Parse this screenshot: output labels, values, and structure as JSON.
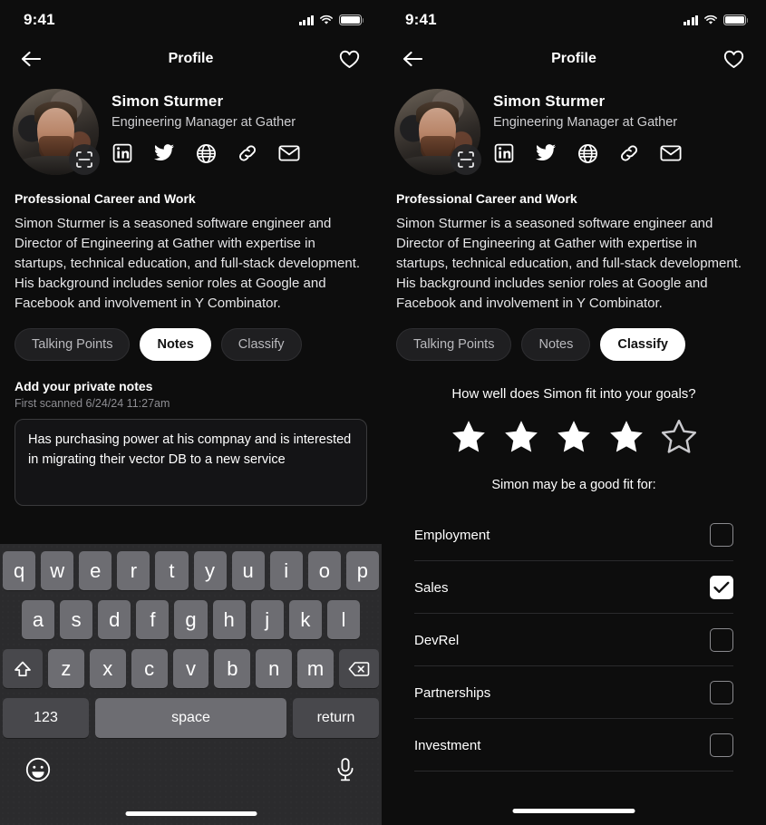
{
  "panels": {
    "left": {
      "status": {
        "time": "9:41",
        "cellular_icon": "signal-bars-icon",
        "wifi_icon": "wifi-icon",
        "battery_icon": "battery-full-icon"
      },
      "nav": {
        "back_icon": "back-arrow-icon",
        "title": "Profile",
        "favorite_icon": "heart-icon"
      },
      "profile": {
        "avatar_name": "profile-photo",
        "scan_badge_icon": "scan-frame-icon",
        "name": "Simon Sturmer",
        "role": "Engineering Manager at Gather",
        "socials": [
          "linkedin-icon",
          "twitter-icon",
          "globe-icon",
          "link-icon",
          "email-icon"
        ]
      },
      "bio": {
        "heading": "Professional Career and Work",
        "text": "Simon Sturmer is a seasoned software engineer and Director of Engineering at Gather with expertise in startups, technical education, and full-stack development. His background includes senior roles at Google and Facebook and involvement in Y Combinator."
      },
      "tabs": [
        {
          "label": "Talking Points",
          "active": false
        },
        {
          "label": "Notes",
          "active": true
        },
        {
          "label": "Classify",
          "active": false
        }
      ],
      "notes": {
        "heading": "Add your private notes",
        "subtext": "First scanned 6/24/24 11:27am",
        "value": "Has purchasing power at his compnay and is interested in migrating their vector DB to a new service",
        "placeholder": "Add your private notes"
      },
      "keyboard": {
        "row1": [
          "q",
          "w",
          "e",
          "r",
          "t",
          "y",
          "u",
          "i",
          "o",
          "p"
        ],
        "row2": [
          "a",
          "s",
          "d",
          "f",
          "g",
          "h",
          "j",
          "k",
          "l"
        ],
        "row3": [
          "z",
          "x",
          "c",
          "v",
          "b",
          "n",
          "m"
        ],
        "shift_icon": "shift-up-icon",
        "backspace_icon": "backspace-icon",
        "numbers_label": "123",
        "space_label": "space",
        "return_label": "return",
        "emoji_icon": "emoji-smiley-icon",
        "dictate_icon": "microphone-icon"
      }
    },
    "right": {
      "status": {
        "time": "9:41",
        "cellular_icon": "signal-bars-icon",
        "wifi_icon": "wifi-icon",
        "battery_icon": "battery-full-icon"
      },
      "nav": {
        "back_icon": "back-arrow-icon",
        "title": "Profile",
        "favorite_icon": "heart-icon"
      },
      "profile": {
        "avatar_name": "profile-photo",
        "scan_badge_icon": "scan-frame-icon",
        "name": "Simon Sturmer",
        "role": "Engineering Manager at Gather",
        "socials": [
          "linkedin-icon",
          "twitter-icon",
          "globe-icon",
          "link-icon",
          "email-icon"
        ]
      },
      "bio": {
        "heading": "Professional Career and Work",
        "text": "Simon Sturmer is a seasoned software engineer and Director of Engineering at Gather with expertise in startups, technical education, and full-stack development. His background includes senior roles at Google and Facebook and involvement in Y Combinator."
      },
      "tabs": [
        {
          "label": "Talking Points",
          "active": false
        },
        {
          "label": "Notes",
          "active": false
        },
        {
          "label": "Classify",
          "active": true
        }
      ],
      "classify": {
        "question": "How well does Simon fit into your goals?",
        "rating": 4,
        "rating_max": 5,
        "fit_heading": "Simon may be a good fit for:",
        "options": [
          {
            "label": "Employment",
            "checked": false
          },
          {
            "label": "Sales",
            "checked": true
          },
          {
            "label": "DevRel",
            "checked": false
          },
          {
            "label": "Partnerships",
            "checked": false
          },
          {
            "label": "Investment",
            "checked": false
          }
        ]
      }
    }
  },
  "colors": {
    "background": "#0d0d0d",
    "accent": "#ffffff",
    "tab_inactive_bg": "#1f1f21",
    "keyboard_bg": "#2b2b2d",
    "key_bg": "#6d6d72",
    "key_dark_bg": "#48484c",
    "muted_text": "#8e8e93"
  }
}
